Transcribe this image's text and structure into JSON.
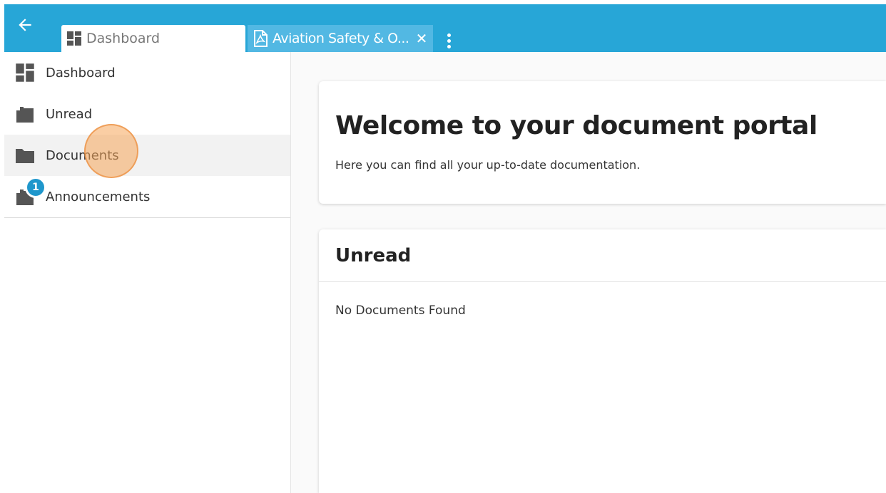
{
  "tabs": [
    {
      "label": "Dashboard",
      "icon": "dashboard-icon"
    },
    {
      "label": "Aviation Safety & O...",
      "icon": "pdf-document-icon"
    }
  ],
  "sidebar": {
    "items": [
      {
        "label": "Dashboard",
        "icon": "dashboard-icon"
      },
      {
        "label": "Unread",
        "icon": "folder-open-icon"
      },
      {
        "label": "Documents",
        "icon": "folder-icon",
        "active": true
      },
      {
        "label": "Announcements",
        "icon": "folder-open-icon",
        "badge": "1"
      }
    ]
  },
  "welcome": {
    "title": "Welcome to your document portal",
    "subtitle": "Here you can find all your up-to-date documentation."
  },
  "unread": {
    "title": "Unread",
    "empty": "No Documents Found"
  },
  "colors": {
    "topbar": "#27a6d7",
    "active_tab_bg": "#ffffff",
    "doc_tab_bg": "#52b8e3",
    "badge": "#1f97cc",
    "cursor_highlight": "#f5a55a"
  }
}
